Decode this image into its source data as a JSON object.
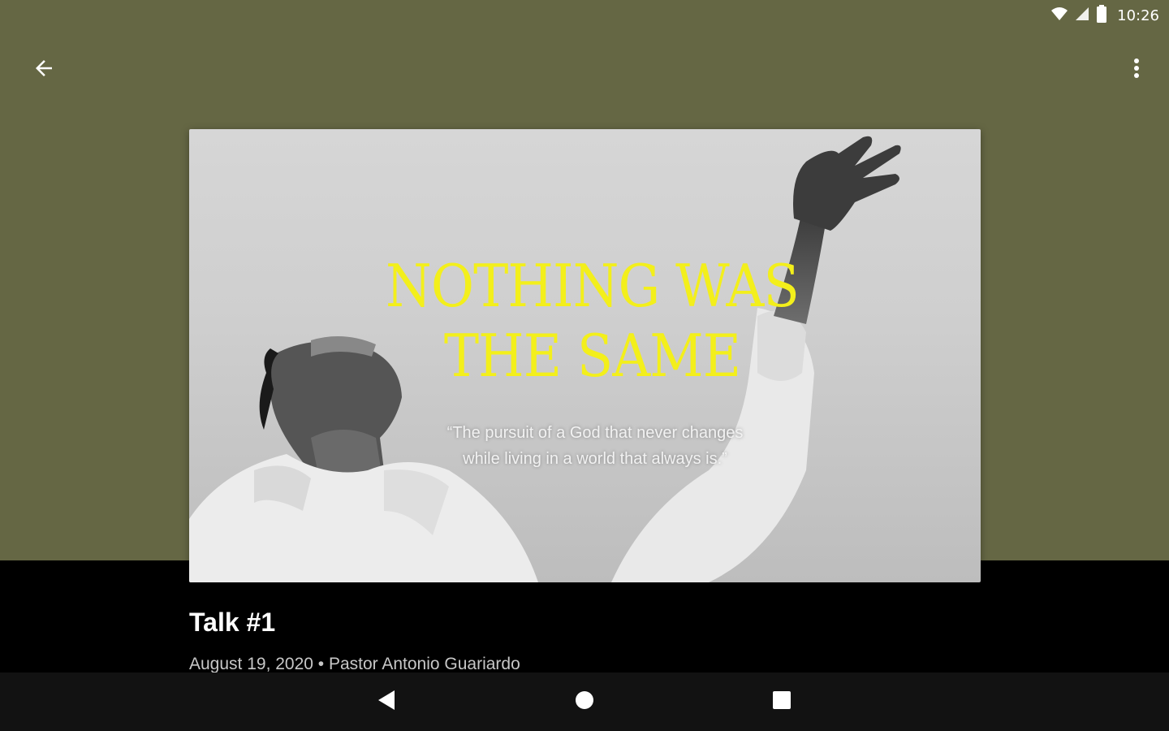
{
  "status_bar": {
    "time": "10:26",
    "icons": [
      "wifi-icon",
      "signal-icon",
      "battery-icon"
    ]
  },
  "app_bar": {
    "back_icon": "arrow-back-icon",
    "menu_icon": "more-vert-icon"
  },
  "hero": {
    "title_line1": "NOTHING WAS",
    "title_line2": "THE SAME",
    "quote_line1": "“The pursuit of a God that never changes",
    "quote_line2": "while living in a world that always is.”"
  },
  "talk": {
    "title": "Talk #1",
    "meta": "August 19, 2020 • Pastor Antonio Guariardo"
  },
  "nav": {
    "icons": [
      "nav-back-icon",
      "nav-home-icon",
      "nav-recents-icon"
    ]
  },
  "colors": {
    "header_bg": "#656744",
    "title_yellow": "#f3ef1b",
    "page_bg": "#000000",
    "nav_bg": "#121212"
  }
}
